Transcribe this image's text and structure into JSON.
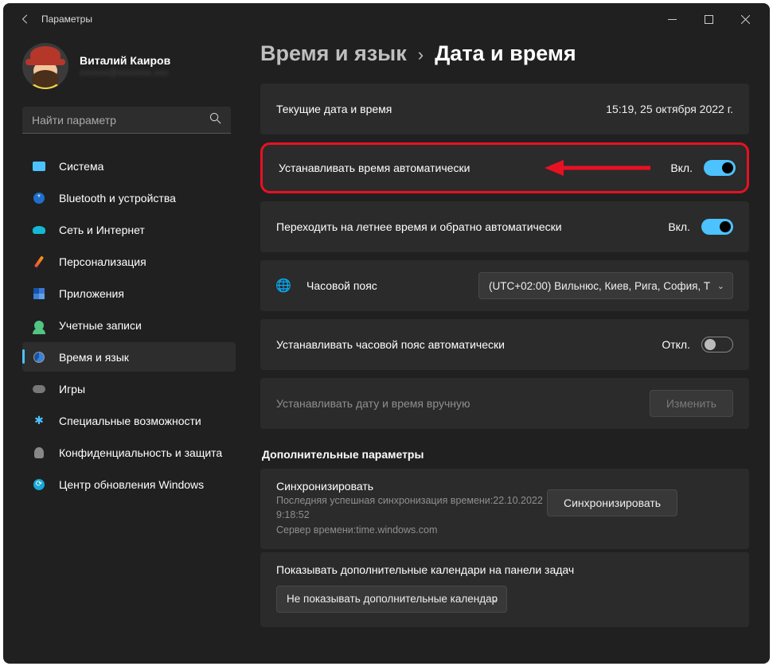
{
  "window_title": "Параметры",
  "user": {
    "name": "Виталий Каиров",
    "email_masked": "xxxxxx@xxxxxxx.xxx"
  },
  "search": {
    "placeholder": "Найти параметр"
  },
  "sidebar": {
    "items": [
      {
        "label": "Система"
      },
      {
        "label": "Bluetooth и устройства"
      },
      {
        "label": "Сеть и Интернет"
      },
      {
        "label": "Персонализация"
      },
      {
        "label": "Приложения"
      },
      {
        "label": "Учетные записи"
      },
      {
        "label": "Время и язык"
      },
      {
        "label": "Игры"
      },
      {
        "label": "Специальные возможности"
      },
      {
        "label": "Конфиденциальность и защита"
      },
      {
        "label": "Центр обновления Windows"
      }
    ],
    "active_index": 6
  },
  "breadcrumb": {
    "parent": "Время и язык",
    "sep": "›",
    "current": "Дата и время"
  },
  "cards": {
    "current": {
      "label": "Текущие дата и время",
      "value": "15:19, 25 октября 2022 г."
    },
    "auto_time": {
      "label": "Устанавливать время автоматически",
      "state": "Вкл."
    },
    "dst": {
      "label": "Переходить на летнее время и обратно автоматически",
      "state": "Вкл."
    },
    "timezone": {
      "label": "Часовой пояс",
      "value": "(UTC+02:00) Вильнюс, Киев, Рига, София, Т"
    },
    "auto_tz": {
      "label": "Устанавливать часовой пояс автоматически",
      "state": "Откл."
    },
    "manual": {
      "label": "Устанавливать дату и время вручную",
      "button": "Изменить"
    }
  },
  "additional": {
    "title": "Дополнительные параметры",
    "sync": {
      "title": "Синхронизировать",
      "lastsync": "Последняя успешная синхронизация времени:22.10.2022 9:18:52",
      "server": "Сервер времени:time.windows.com",
      "button": "Синхронизировать"
    },
    "calendars": {
      "title": "Показывать дополнительные календари на панели задач",
      "value": "Не показывать дополнительные календар"
    }
  }
}
